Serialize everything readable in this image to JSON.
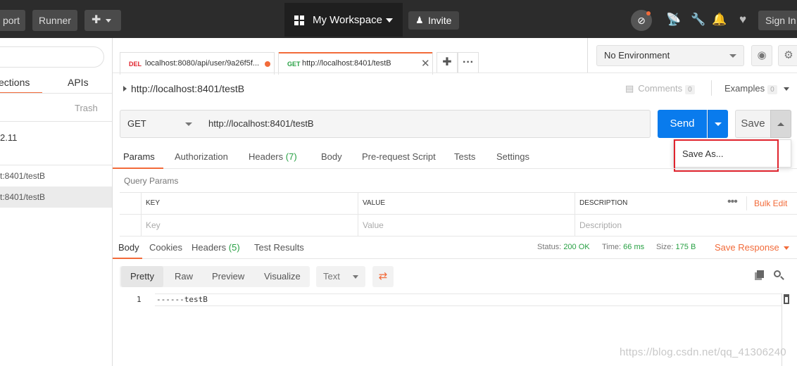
{
  "topbar": {
    "import_label": "port",
    "runner_label": "Runner",
    "workspace_label": "My Workspace",
    "invite_label": "Invite",
    "signin_label": "Sign In"
  },
  "sidebar": {
    "tabs": [
      {
        "label": "ections"
      },
      {
        "label": "APIs"
      }
    ],
    "trash_label": "Trash",
    "version_label": "2.11",
    "items": [
      {
        "label": "t:8401/testB"
      },
      {
        "label": "t:8401/testB"
      }
    ]
  },
  "request_tabs": [
    {
      "method": "DEL",
      "url": "localhost:8080/api/user/9a26f5f...",
      "method_color": "#e0242e"
    },
    {
      "method": "GET",
      "url": "http://localhost:8401/testB",
      "method_color": "#27a043"
    }
  ],
  "environment": {
    "selected": "No Environment"
  },
  "request": {
    "title": "http://localhost:8401/testB",
    "comments_label": "Comments",
    "comments_count": "0",
    "examples_label": "Examples",
    "examples_count": "0",
    "method": "GET",
    "url": "http://localhost:8401/testB",
    "send_label": "Send",
    "save_label": "Save",
    "save_menu": {
      "save_as": "Save As..."
    }
  },
  "request_subtabs": {
    "params": "Params",
    "authorization": "Authorization",
    "headers": "Headers",
    "headers_count": "(7)",
    "body": "Body",
    "prerequest": "Pre-request Script",
    "tests": "Tests",
    "settings": "Settings"
  },
  "params": {
    "section_label": "Query Params",
    "columns": {
      "key": "KEY",
      "value": "VALUE",
      "description": "DESCRIPTION"
    },
    "placeholders": {
      "key": "Key",
      "value": "Value",
      "description": "Description"
    },
    "bulk_edit": "Bulk Edit"
  },
  "response": {
    "tabs": {
      "body": "Body",
      "cookies": "Cookies",
      "headers": "Headers",
      "headers_count": "(5)",
      "test_results": "Test Results"
    },
    "status_label": "Status:",
    "status_value": "200 OK",
    "time_label": "Time:",
    "time_value": "66 ms",
    "size_label": "Size:",
    "size_value": "175 B",
    "save_response": "Save Response",
    "views": {
      "pretty": "Pretty",
      "raw": "Raw",
      "preview": "Preview",
      "visualize": "Visualize"
    },
    "format": "Text",
    "line_number": "1",
    "body_text": "------testB"
  },
  "watermark": "https://blog.csdn.net/qq_41306240",
  "colors": {
    "accent": "#f26b3a",
    "send": "#097bed",
    "ok": "#27a043",
    "highlight": "#e0242e"
  }
}
